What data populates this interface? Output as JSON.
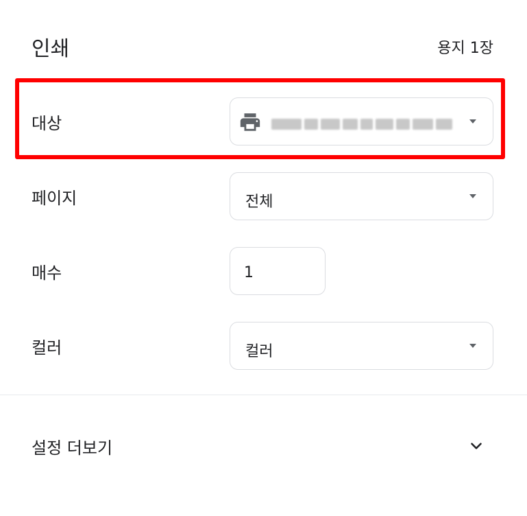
{
  "header": {
    "title": "인쇄",
    "sheet_count": "용지 1장"
  },
  "destination": {
    "label": "대상",
    "icon": "printer-icon",
    "value_redacted": true
  },
  "pages": {
    "label": "페이지",
    "value": "전체"
  },
  "copies": {
    "label": "매수",
    "value": "1"
  },
  "color": {
    "label": "컬러",
    "value": "컬러"
  },
  "more_settings": {
    "label": "설정 더보기",
    "icon": "chevron-down-icon"
  },
  "colors": {
    "highlight": "#ff0000",
    "border": "#dadce0",
    "icon": "#5f6368",
    "text": "#202124"
  }
}
